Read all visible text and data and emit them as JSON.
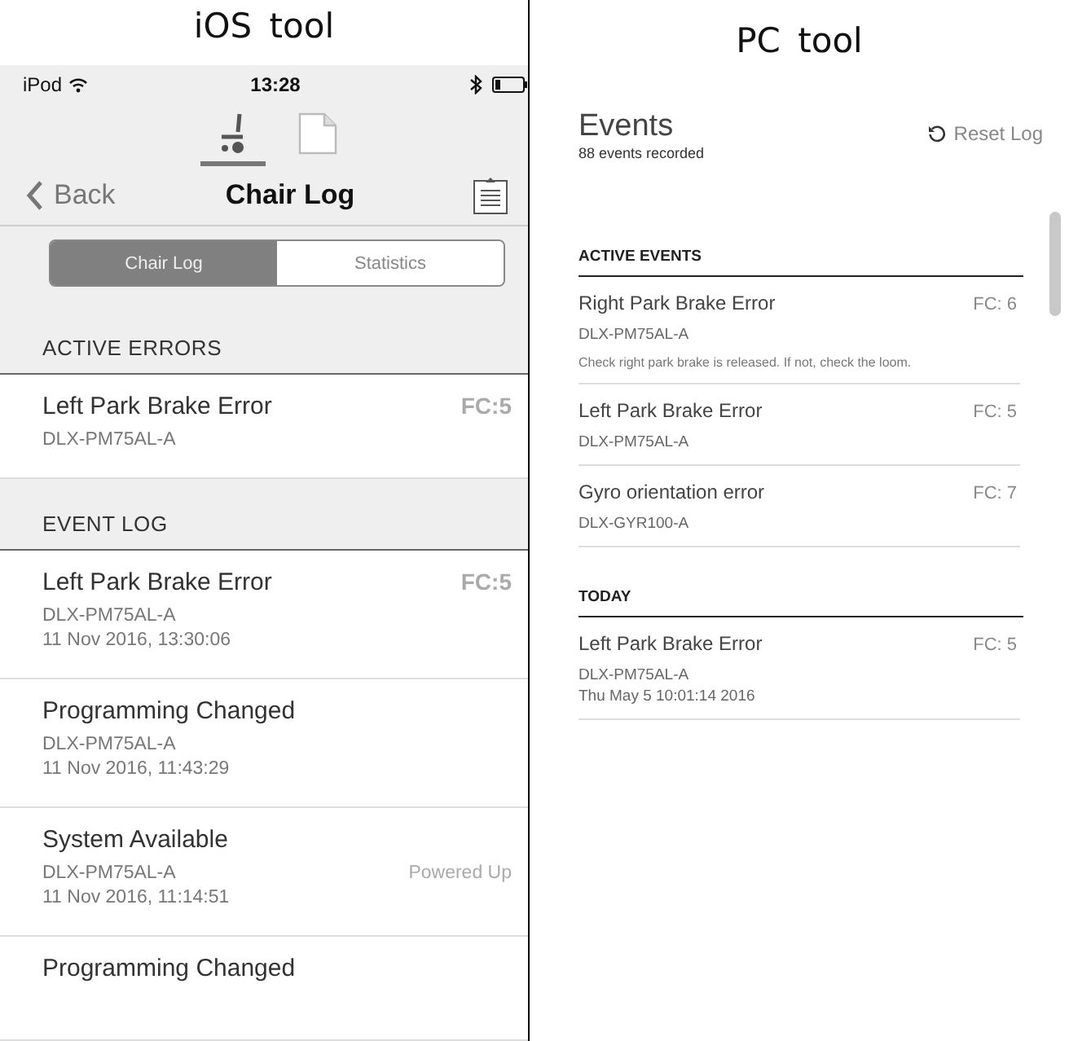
{
  "captions": [
    "iOS tool",
    "PC tool"
  ],
  "ios": {
    "status": {
      "carrier": "iPod",
      "time": "13:28"
    },
    "tabs": [
      {
        "kind": "chair",
        "selected": true
      },
      {
        "kind": "document",
        "selected": false
      }
    ],
    "nav": {
      "back": "Back",
      "title": "Chair Log"
    },
    "segments": [
      {
        "label": "Chair Log",
        "selected": true
      },
      {
        "label": "Statistics",
        "selected": false
      }
    ],
    "sections": [
      {
        "title": "ACTIVE ERRORS",
        "items": [
          {
            "name": "Left Park Brake Error",
            "code": "FC:5",
            "device": "DLX-PM75AL-A"
          }
        ]
      },
      {
        "title": "EVENT LOG",
        "items": [
          {
            "name": "Left Park Brake Error",
            "code": "FC:5",
            "device": "DLX-PM75AL-A",
            "time": "11 Nov 2016, 13:30:06"
          },
          {
            "name": "Programming Changed",
            "device": "DLX-PM75AL-A",
            "time": "11 Nov 2016, 11:43:29"
          },
          {
            "name": "System Available",
            "device": "DLX-PM75AL-A",
            "status": "Powered Up",
            "time": "11 Nov 2016, 11:14:51"
          },
          {
            "name": "Programming Changed"
          }
        ]
      }
    ]
  },
  "pc": {
    "title": "Events",
    "subtitle": "88 events recorded",
    "reset": "Reset Log",
    "sections": [
      {
        "title": "ACTIVE EVENTS",
        "items": [
          {
            "name": "Right Park Brake Error",
            "code": "FC: 6",
            "device": "DLX-PM75AL-A",
            "note": "Check right park brake is released. If not, check the loom."
          },
          {
            "name": "Left Park Brake Error",
            "code": "FC: 5",
            "device": "DLX-PM75AL-A"
          },
          {
            "name": "Gyro orientation error",
            "code": "FC: 7",
            "device": "DLX-GYR100-A"
          }
        ]
      },
      {
        "title": "TODAY",
        "items": [
          {
            "name": "Left Park Brake Error",
            "code": "FC: 5",
            "device": "DLX-PM75AL-A",
            "time": "Thu May 5 10:01:14 2016"
          }
        ]
      }
    ]
  }
}
